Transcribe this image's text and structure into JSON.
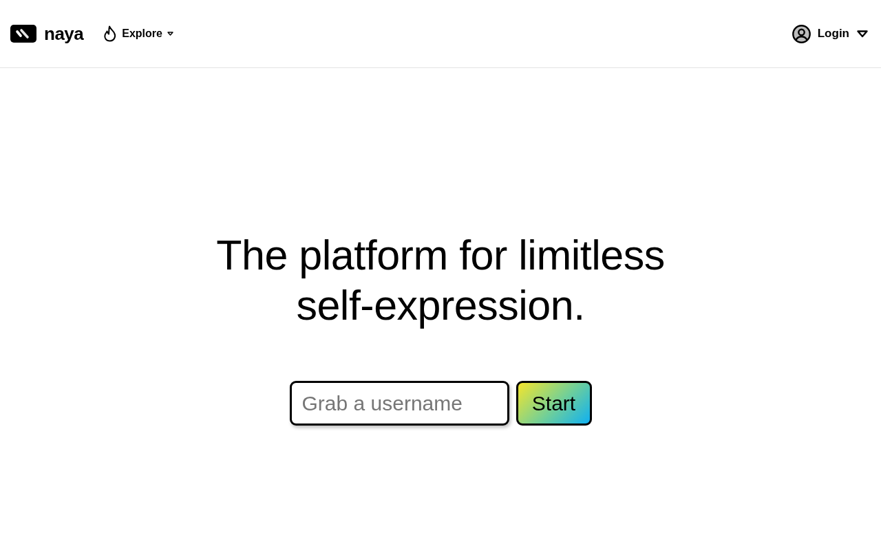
{
  "header": {
    "logo": {
      "text": "naya"
    },
    "nav": [
      {
        "label": "Explore"
      }
    ],
    "account": {
      "label": "Login"
    }
  },
  "hero": {
    "headline": "The platform for limitless self-expression.",
    "username_field": {
      "placeholder": "Grab a username"
    },
    "start_button": {
      "label": "Start"
    }
  }
}
